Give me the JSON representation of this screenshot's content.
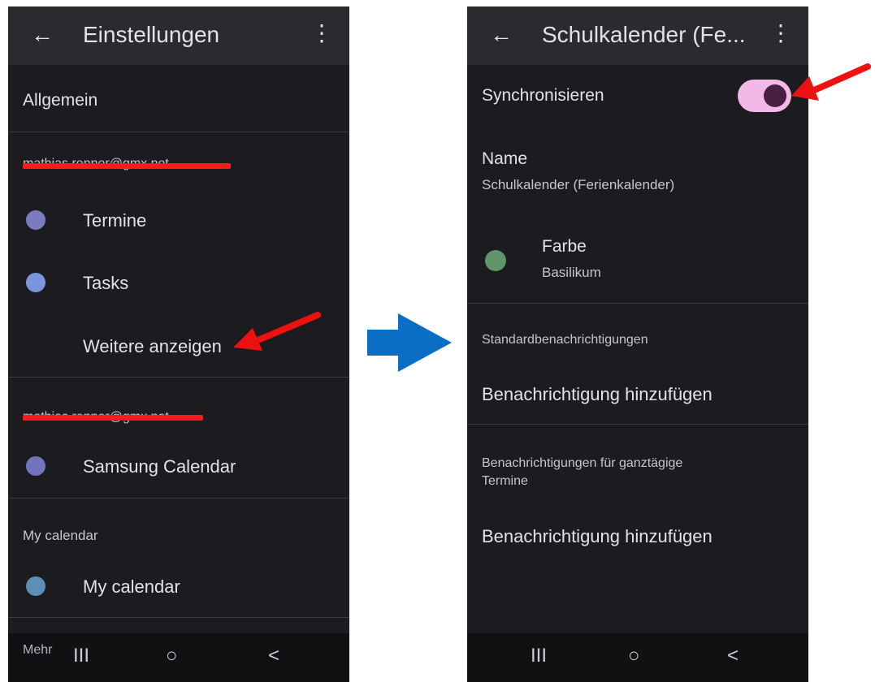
{
  "left_screen": {
    "header": {
      "back_icon": "arrow-left-icon",
      "title": "Einstellungen",
      "more_icon": "more-vert-icon"
    },
    "general": "Allgemein",
    "account_1": {
      "email": "mathias.renner@gmx.net",
      "redacted": true
    },
    "calendars_1": [
      {
        "label": "Termine",
        "color": "#7b7bc0"
      },
      {
        "label": "Tasks",
        "color": "#7b96e0"
      }
    ],
    "show_more": "Weitere anzeigen",
    "account_2": {
      "email": "mathias.renner@gmx.net",
      "redacted": true
    },
    "calendars_2": [
      {
        "label": "Samsung Calendar",
        "color": "#7272bf"
      }
    ],
    "section_my_calendar": "My calendar",
    "calendars_3": [
      {
        "label": "My calendar",
        "color": "#5b8fb5"
      }
    ],
    "nav": {
      "extra_label": "Mehr",
      "recents": "III",
      "home": "○",
      "back": "<"
    }
  },
  "right_screen": {
    "header": {
      "back_icon": "arrow-left-icon",
      "title": "Schulkalender (Fe...",
      "more_icon": "more-vert-icon"
    },
    "sync": {
      "label": "Synchronisieren",
      "enabled": true
    },
    "name": {
      "label": "Name",
      "value": "Schulkalender (Ferienkalender)"
    },
    "color": {
      "label": "Farbe",
      "value": "Basilikum",
      "swatch": "#5f9568"
    },
    "default_notifications": {
      "heading": "Standardbenachrichtigungen",
      "action": "Benachrichtigung hinzufügen"
    },
    "allday_notifications": {
      "heading_line1": "Benachrichtigungen für ganztägige",
      "heading_line2": "Termine",
      "action": "Benachrichtigung hinzufügen"
    },
    "nav": {
      "recents": "III",
      "home": "○",
      "back": "<"
    }
  },
  "annotations": {
    "annotation_color": "#ee1111",
    "flow_arrow_color": "#0a6fc4"
  }
}
